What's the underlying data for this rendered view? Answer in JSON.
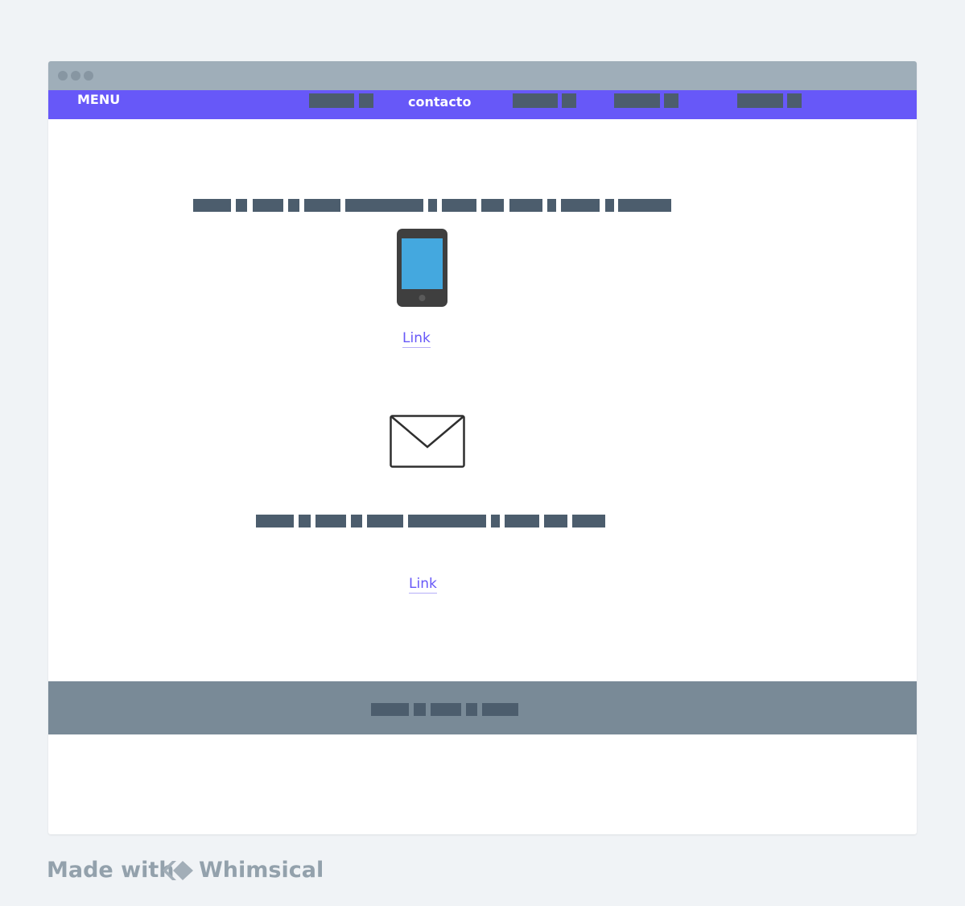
{
  "navbar": {
    "menu_label": "MENU",
    "contact_label": "contacto",
    "color": "#6758f8"
  },
  "phone_section": {
    "icon": "phone-icon",
    "link_label": "Link"
  },
  "mail_section": {
    "icon": "envelope-icon",
    "link_label": "Link"
  },
  "branding": {
    "made_with": "Made with",
    "brand": "Whimsical"
  }
}
